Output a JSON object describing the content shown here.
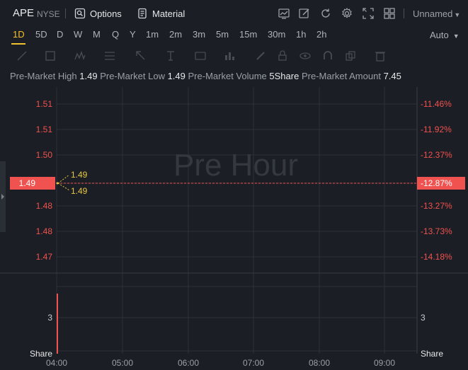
{
  "header": {
    "symbol": "APE",
    "exchange": "NYSE",
    "options_label": "Options",
    "material_label": "Material",
    "layout_name": "Unnamed"
  },
  "periods": {
    "items": [
      "1D",
      "5D",
      "D",
      "W",
      "M",
      "Q",
      "Y",
      "1m",
      "2m",
      "3m",
      "5m",
      "15m",
      "30m",
      "1h",
      "2h"
    ],
    "active": "1D",
    "scale_mode": "Auto"
  },
  "info": {
    "high_label": "Pre-Market High",
    "high_value": "1.49",
    "low_label": "Pre-Market Low",
    "low_value": "1.49",
    "volume_label": "Pre-Market Volume",
    "volume_value": "5Share",
    "amount_label": "Pre-Market Amount",
    "amount_value": "7.45"
  },
  "chart_data": {
    "type": "line",
    "watermark": "Pre Hour",
    "price_axis": [
      "1.51",
      "1.51",
      "1.50",
      "1.49",
      "1.48",
      "1.48",
      "1.47"
    ],
    "percent_axis": [
      "-11.46%",
      "-11.92%",
      "-12.37%",
      "-12.87%",
      "-13.27%",
      "-13.73%",
      "-14.18%"
    ],
    "current_price": "1.49",
    "current_percent": "-12.87%",
    "marker_high": "1.49",
    "marker_low": "1.49",
    "volume_axis_value": "3",
    "volume_unit": "Share",
    "x_ticks": [
      "04:00",
      "05:00",
      "06:00",
      "07:00",
      "08:00",
      "09:00"
    ],
    "series": [
      {
        "x": [
          "04:00"
        ],
        "price": [
          1.49
        ],
        "volume": [
          5
        ]
      }
    ],
    "colors": {
      "down": "#f0524f",
      "marker": "#e8c840",
      "grid": "#2c3038"
    }
  }
}
